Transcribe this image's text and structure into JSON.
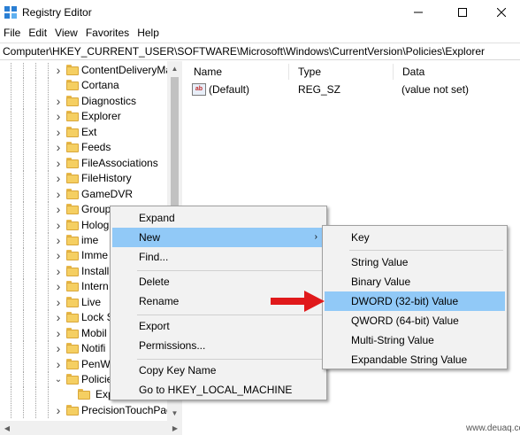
{
  "window": {
    "title": "Registry Editor",
    "icon": "registry-editor-icon"
  },
  "menu": [
    "File",
    "Edit",
    "View",
    "Favorites",
    "Help"
  ],
  "address": "Computer\\HKEY_CURRENT_USER\\SOFTWARE\\Microsoft\\Windows\\CurrentVersion\\Policies\\Explorer",
  "tree": {
    "items": [
      {
        "label": "ContentDeliveryMa",
        "chevron": ">"
      },
      {
        "label": "Cortana",
        "chevron": ""
      },
      {
        "label": "Diagnostics",
        "chevron": ">"
      },
      {
        "label": "Explorer",
        "chevron": ">"
      },
      {
        "label": "Ext",
        "chevron": ">"
      },
      {
        "label": "Feeds",
        "chevron": ">"
      },
      {
        "label": "FileAssociations",
        "chevron": ">"
      },
      {
        "label": "FileHistory",
        "chevron": ">"
      },
      {
        "label": "GameDVR",
        "chevron": ">"
      },
      {
        "label": "Group",
        "chevron": ">"
      },
      {
        "label": "Holog",
        "chevron": ">"
      },
      {
        "label": "ime",
        "chevron": ">"
      },
      {
        "label": "Imme",
        "chevron": ">"
      },
      {
        "label": "Install",
        "chevron": ">"
      },
      {
        "label": "Intern",
        "chevron": ">"
      },
      {
        "label": "Live",
        "chevron": ">"
      },
      {
        "label": "Lock S",
        "chevron": ">"
      },
      {
        "label": "Mobil",
        "chevron": ">"
      },
      {
        "label": "Notifi",
        "chevron": ">"
      },
      {
        "label": "PenW",
        "chevron": ">"
      },
      {
        "label": "Policie",
        "chevron": "v"
      },
      {
        "label": "Exp",
        "chevron": ""
      },
      {
        "label": "PrecisionTouchPad",
        "chevron": ">"
      }
    ]
  },
  "columns": {
    "name": "Name",
    "type": "Type",
    "data": "Data"
  },
  "values": [
    {
      "icon": "ab",
      "name": "(Default)",
      "type": "REG_SZ",
      "data": "(value not set)"
    }
  ],
  "context_menu": {
    "items": [
      "Expand",
      "New",
      "Find...",
      "Delete",
      "Rename",
      "Export",
      "Permissions...",
      "Copy Key Name",
      "Go to HKEY_LOCAL_MACHINE"
    ]
  },
  "new_submenu": {
    "items": [
      "Key",
      "String Value",
      "Binary Value",
      "DWORD (32-bit) Value",
      "QWORD (64-bit) Value",
      "Multi-String Value",
      "Expandable String Value"
    ]
  },
  "watermark": "www.deuaq.com",
  "colors": {
    "highlight": "#91c9f7",
    "arrow": "#e0191b",
    "folder": "#f5cf62"
  }
}
